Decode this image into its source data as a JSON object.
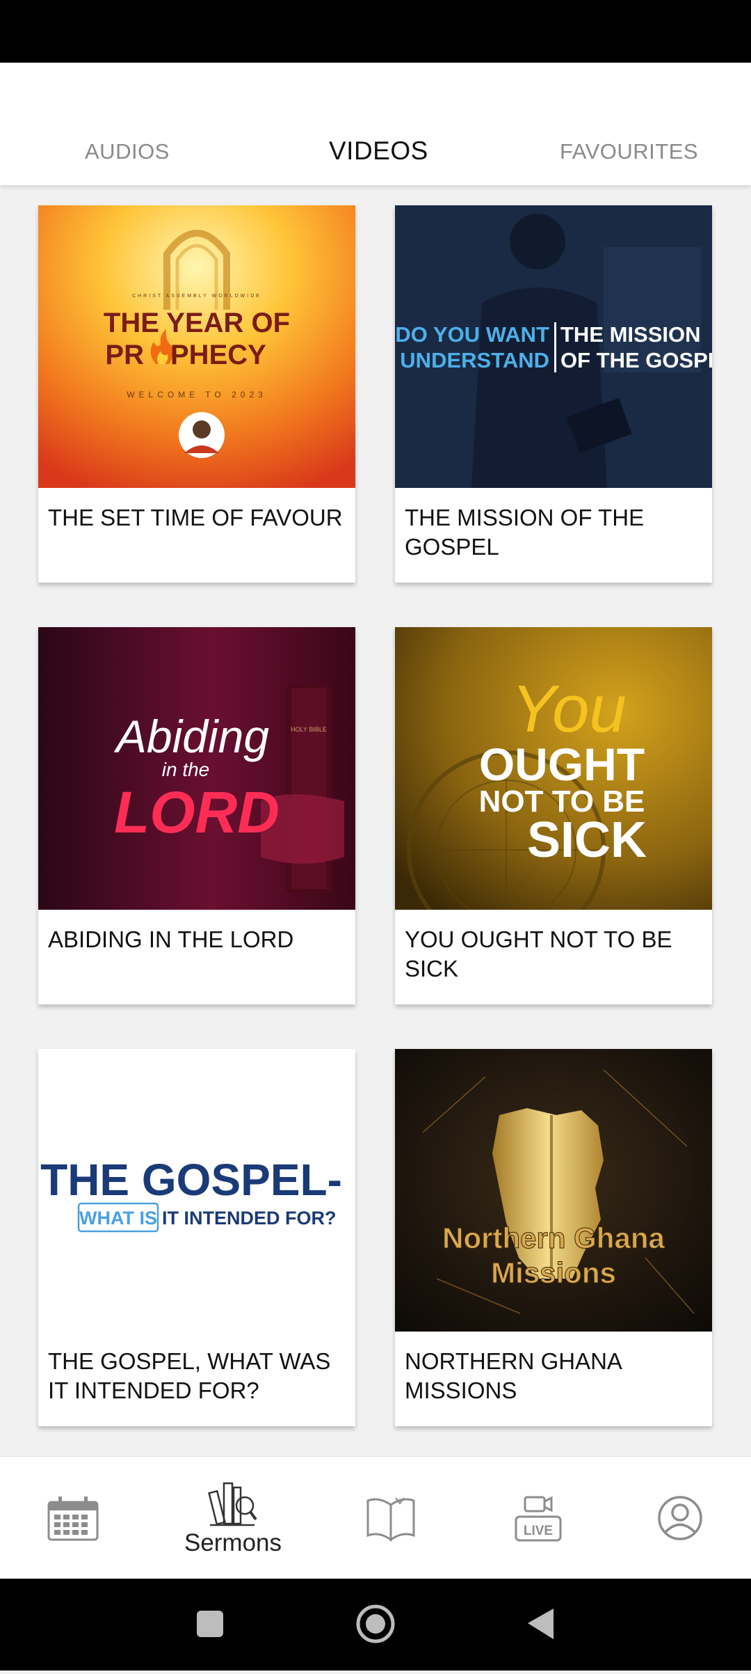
{
  "tabs": [
    {
      "label": "AUDIOS"
    },
    {
      "label": "VIDEOS"
    },
    {
      "label": "FAVOURITES"
    }
  ],
  "active_tab": "VIDEOS",
  "videos": [
    {
      "title": "THE SET TIME OF FAVOUR",
      "thumb": {
        "small": "CHRIST ASSEMBLY WORLDWIDE",
        "line1": "THE YEAR OF",
        "line2": "PR",
        "line3": "PHECY",
        "sub": "WELCOME TO 2023"
      }
    },
    {
      "title": "THE MISSION OF THE GOSPEL",
      "thumb": {
        "left1": "DO YOU WANT",
        "left2": "TO UNDERSTAND",
        "right1": "THE MISSION",
        "right2": "OF THE GOSPEL?"
      }
    },
    {
      "title": "ABIDING IN THE LORD",
      "thumb": {
        "script1": "Abiding",
        "script2": "in the",
        "bold": "LORD",
        "bible": "HOLY BIBLE"
      }
    },
    {
      "title": "YOU OUGHT NOT TO BE SICK",
      "thumb": {
        "script": "You",
        "line1": "OUGHT",
        "line2": "NOT TO BE",
        "line3": "SICK"
      }
    },
    {
      "title": "THE GOSPEL, WHAT WAS IT INTENDED FOR?",
      "thumb": {
        "line1": "THE GOSPEL-",
        "boxed": "WHAT IS",
        "rest": "IT INTENDED FOR?"
      }
    },
    {
      "title": "NORTHERN GHANA MISSIONS",
      "thumb": {
        "line1": "Northern Ghana",
        "line2": "Missions"
      }
    }
  ],
  "bottom_nav": [
    {
      "icon": "calendar-icon",
      "label": ""
    },
    {
      "icon": "sermons-icon",
      "label": "Sermons"
    },
    {
      "icon": "open-book-icon",
      "label": ""
    },
    {
      "icon": "live-camera-icon",
      "label": ""
    },
    {
      "icon": "profile-icon",
      "label": ""
    }
  ],
  "colors": {
    "background": "#f1f1f1",
    "tab_inactive": "#8a8a8a",
    "tab_active": "#111111",
    "nav_icon": "#8c8c8c"
  }
}
